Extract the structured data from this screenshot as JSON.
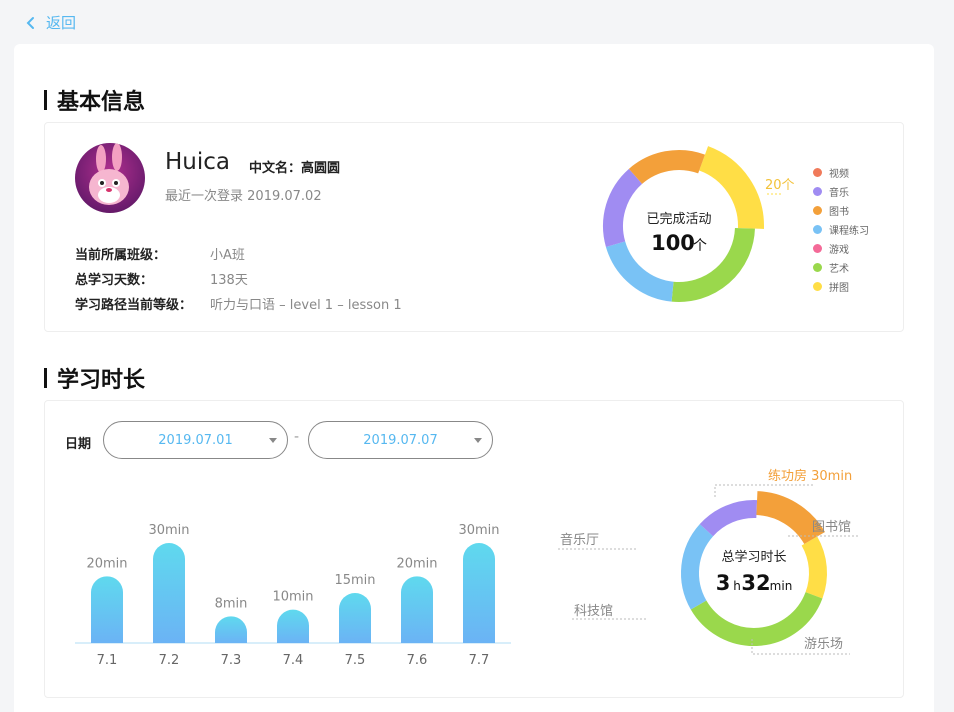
{
  "nav": {
    "back_label": "返回"
  },
  "basic": {
    "section_title": "基本信息",
    "username": "Huica",
    "cn_name_label": "中文名：",
    "cn_name": "高圆圆",
    "last_login_label": "最近一次登录",
    "last_login_date": "2019.07.02",
    "rows": [
      {
        "key": "当前所属班级：",
        "value": "小A班"
      },
      {
        "key": "总学习天数：",
        "value": "138天"
      },
      {
        "key": "学习路径当前等级：",
        "value": "听力与口语 – level 1 – lesson 1"
      }
    ],
    "activity": {
      "center_label": "已完成活动",
      "center_value": "100",
      "center_unit": "个",
      "callout": "20个",
      "legend": [
        "视频",
        "音乐",
        "图书",
        "课程练习",
        "游戏",
        "艺术",
        "拼图"
      ],
      "colors": [
        "#f07a5a",
        "#a08cf2",
        "#f3a03a",
        "#79c2f5",
        "#f46a98",
        "#9ad84c",
        "#ffde46"
      ]
    }
  },
  "study": {
    "section_title": "学习时长",
    "date_label": "日期",
    "date_from": "2019.07.01",
    "date_to": "2019.07.07",
    "date_sep": "-",
    "total": {
      "label": "总学习时长",
      "hours": "3",
      "h_unit": "h",
      "minutes": "32",
      "min_unit": "min"
    },
    "callouts": {
      "practice": "练功房 30min",
      "library": "图书馆",
      "music": "音乐厅",
      "science": "科技馆",
      "playground": "游乐场"
    }
  },
  "chart_data": [
    {
      "type": "bar",
      "categories": [
        "7.1",
        "7.2",
        "7.3",
        "7.4",
        "7.5",
        "7.6",
        "7.7"
      ],
      "values": [
        20,
        30,
        8,
        10,
        15,
        20,
        30
      ],
      "labels": [
        "20min",
        "30min",
        "8min",
        "10min",
        "15min",
        "20min",
        "30min"
      ],
      "ylim": [
        0,
        30
      ],
      "grid": false,
      "colors": {
        "top": "#5fd9ee",
        "bottom": "#6bb3f5"
      }
    },
    {
      "type": "pie",
      "name": "activities",
      "categories": [
        "拼图",
        "艺术",
        "课程练习",
        "音乐",
        "图书"
      ],
      "values": [
        20,
        26,
        19,
        18,
        17
      ],
      "colors": [
        "#ffde46",
        "#9ad84c",
        "#79c2f5",
        "#a08cf2",
        "#f3a03a"
      ]
    },
    {
      "type": "pie",
      "name": "study-time",
      "categories": [
        "图书馆",
        "游乐场",
        "科技馆",
        "音乐厅",
        "练功房"
      ],
      "values": [
        14,
        36,
        20,
        14,
        16
      ],
      "colors": [
        "#ffde46",
        "#9ad84c",
        "#79c2f5",
        "#a08cf2",
        "#f3a03a"
      ]
    }
  ]
}
